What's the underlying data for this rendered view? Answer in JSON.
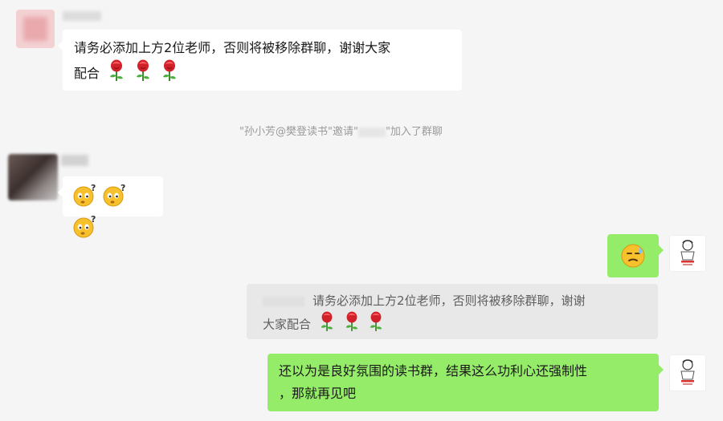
{
  "colors": {
    "background": "#f5f5f5",
    "incoming_bubble": "#ffffff",
    "outgoing_bubble": "#95ec69",
    "quote_bg": "#e8e8e8",
    "system_text": "#9a9a9a"
  },
  "messages": [
    {
      "id": "m1",
      "direction": "incoming",
      "sender": "",
      "lines": [
        "请务必添加上方2位老师，否则将被移除群聊，谢谢大家",
        "配合"
      ],
      "trailing_icons": [
        "rose-icon",
        "rose-icon",
        "rose-icon"
      ]
    },
    {
      "id": "m2",
      "type": "system",
      "parts": [
        "\"孙小芳@樊登读书\"邀请\"",
        "\"加入了群聊"
      ]
    },
    {
      "id": "m3",
      "direction": "incoming",
      "sender": "",
      "emojis": [
        "question-face-emoji",
        "question-face-emoji",
        "question-face-emoji"
      ]
    },
    {
      "id": "m4",
      "direction": "outgoing",
      "emojis": [
        "sweat-smile-emoji"
      ]
    },
    {
      "id": "m5",
      "type": "quote",
      "lines": [
        "请务必添加上方2位老师，否则将被移除群聊，谢谢",
        "大家配合"
      ],
      "trailing_icons": [
        "rose-icon",
        "rose-icon",
        "rose-icon"
      ]
    },
    {
      "id": "m6",
      "direction": "outgoing",
      "lines": [
        "还以为是良好氛围的读书群，结果这么功利心还强制性",
        "，那就再见吧"
      ]
    }
  ]
}
